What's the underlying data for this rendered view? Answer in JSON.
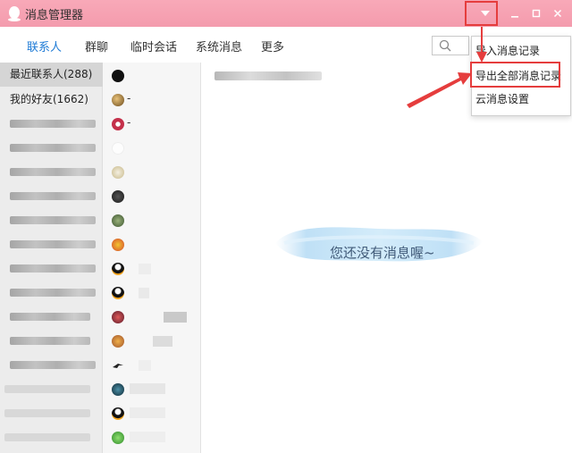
{
  "window": {
    "title": "消息管理器"
  },
  "tabs": [
    {
      "label": "联系人",
      "active": true
    },
    {
      "label": "群聊"
    },
    {
      "label": "临时会话"
    },
    {
      "label": "系统消息"
    },
    {
      "label": "更多"
    }
  ],
  "categories": [
    {
      "label": "最近联系人(288)",
      "selected": true
    },
    {
      "label": "我的好友(1662)"
    }
  ],
  "contacts": [
    {
      "avatar_color": "#111111",
      "label": ""
    },
    {
      "avatar_color": "#8a6a3c",
      "label": "-"
    },
    {
      "avatar_color": "#c4304a",
      "label": "-"
    }
  ],
  "main": {
    "empty_message": "您还没有消息喔~"
  },
  "menu": {
    "items": [
      {
        "label": "导入消息记录"
      },
      {
        "label": "导出全部消息记录",
        "highlighted": true
      },
      {
        "label": "云消息设置"
      }
    ]
  },
  "colors": {
    "title_bar": "#f49bad",
    "accent": "#1f7bd6",
    "highlight": "#e53d3d"
  }
}
